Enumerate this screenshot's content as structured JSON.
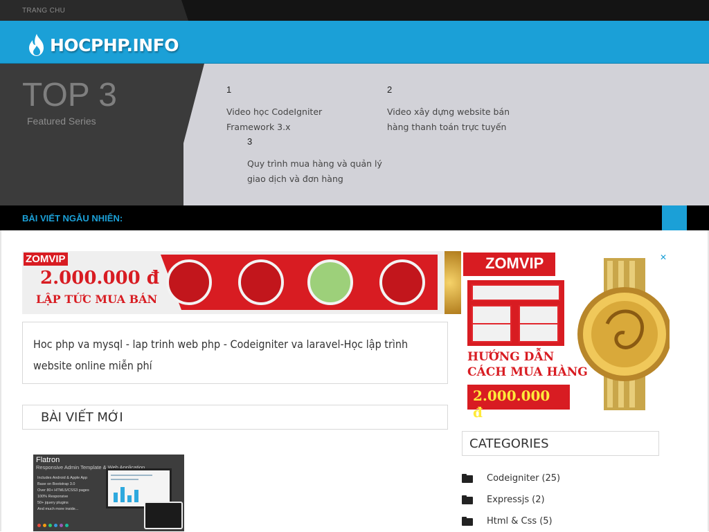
{
  "nav": {
    "home_tab": "TRANG CHU"
  },
  "brand": {
    "logo_text": "HOCPHP.INFO",
    "accent": "#1ba0d7"
  },
  "featured": {
    "title": "TOP 3",
    "subtitle": "Featured Series",
    "items": [
      {
        "num": "1",
        "title": "Video học CodeIgniter Framework 3.x"
      },
      {
        "num": "2",
        "title": "Video xây dựng website bán hàng thanh toán trực tuyến"
      },
      {
        "num": "3",
        "title": "Quy trình mua hàng và quản lý giao dịch và đơn hàng"
      }
    ]
  },
  "random_posts": {
    "label": "BÀI VIẾT NGẪU NHIÊN:"
  },
  "ad_top": {
    "brand": "ZOMVIP",
    "price": "2.000.000 đ",
    "cta": "LẬP TỨC MUA BÁN"
  },
  "site_description": "Hoc php va mysql - lap trinh web php - Codeigniter va laravel-Học lập trình website online miễn phí",
  "new_posts": {
    "heading": "BÀI VIẾT MỚI",
    "thumb": {
      "title": "Flatron",
      "subtitle": "Responsive Admin Template & Web Application",
      "bullets": [
        "Includes Android & Apple App",
        "Base on Bootstrap 3.0",
        "Over 80+ HTML5/CSS3 pages",
        "100% Responsive",
        "50+ jquery plugins",
        "And much more inside..."
      ]
    }
  },
  "ad_right": {
    "brand": "ZOMVIP",
    "guide_line1": "HƯỚNG DẪN",
    "guide_line2": "CÁCH MUA HÀNG",
    "price": "2.000.000 đ",
    "close_glyph": "✕"
  },
  "categories": {
    "heading": "CATEGORIES",
    "items": [
      {
        "name": "Codeigniter",
        "count": "(25)"
      },
      {
        "name": "Expressjs",
        "count": "(2)"
      },
      {
        "name": "Html & Css",
        "count": "(5)"
      }
    ]
  }
}
